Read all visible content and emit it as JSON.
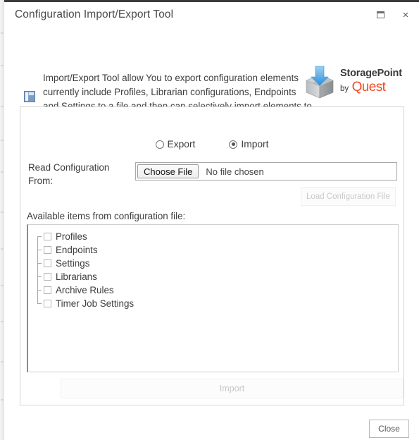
{
  "window": {
    "title": "Configuration Import/Export Tool",
    "restore_icon": "restore-window-icon",
    "close_icon": "close-window-icon",
    "close_glyph": "×"
  },
  "header": {
    "description": "Import/Export Tool allow You to export configuration elements currently include Profiles, Librarian configurations, Endpoints and Settings to a file and then can selectively import elements to different scopes.",
    "info_icon": "configuration-info-icon",
    "logo": {
      "mark_icon": "storagepoint-box-arrow-icon",
      "product": "StoragePoint",
      "by": "by",
      "company": "Quest",
      "accent_color": "#ef4a21"
    }
  },
  "form": {
    "mode_options": [
      {
        "label": "Export",
        "selected": false
      },
      {
        "label": "Import",
        "selected": true
      }
    ],
    "read_from_label": "Read Configuration From:",
    "file_picker": {
      "button_label": "Choose File",
      "file_status": "No file chosen"
    },
    "load_button_label": "Load Configuration File",
    "available_items_label": "Available items from configuration file:",
    "tree_items": [
      {
        "label": "Profiles",
        "checked": false
      },
      {
        "label": "Endpoints",
        "checked": false
      },
      {
        "label": "Settings",
        "checked": false
      },
      {
        "label": "Librarians",
        "checked": false
      },
      {
        "label": "Archive Rules",
        "checked": false
      },
      {
        "label": "Timer Job Settings",
        "checked": false
      }
    ],
    "import_button_label": "Import"
  },
  "footer": {
    "close_label": "Close"
  }
}
